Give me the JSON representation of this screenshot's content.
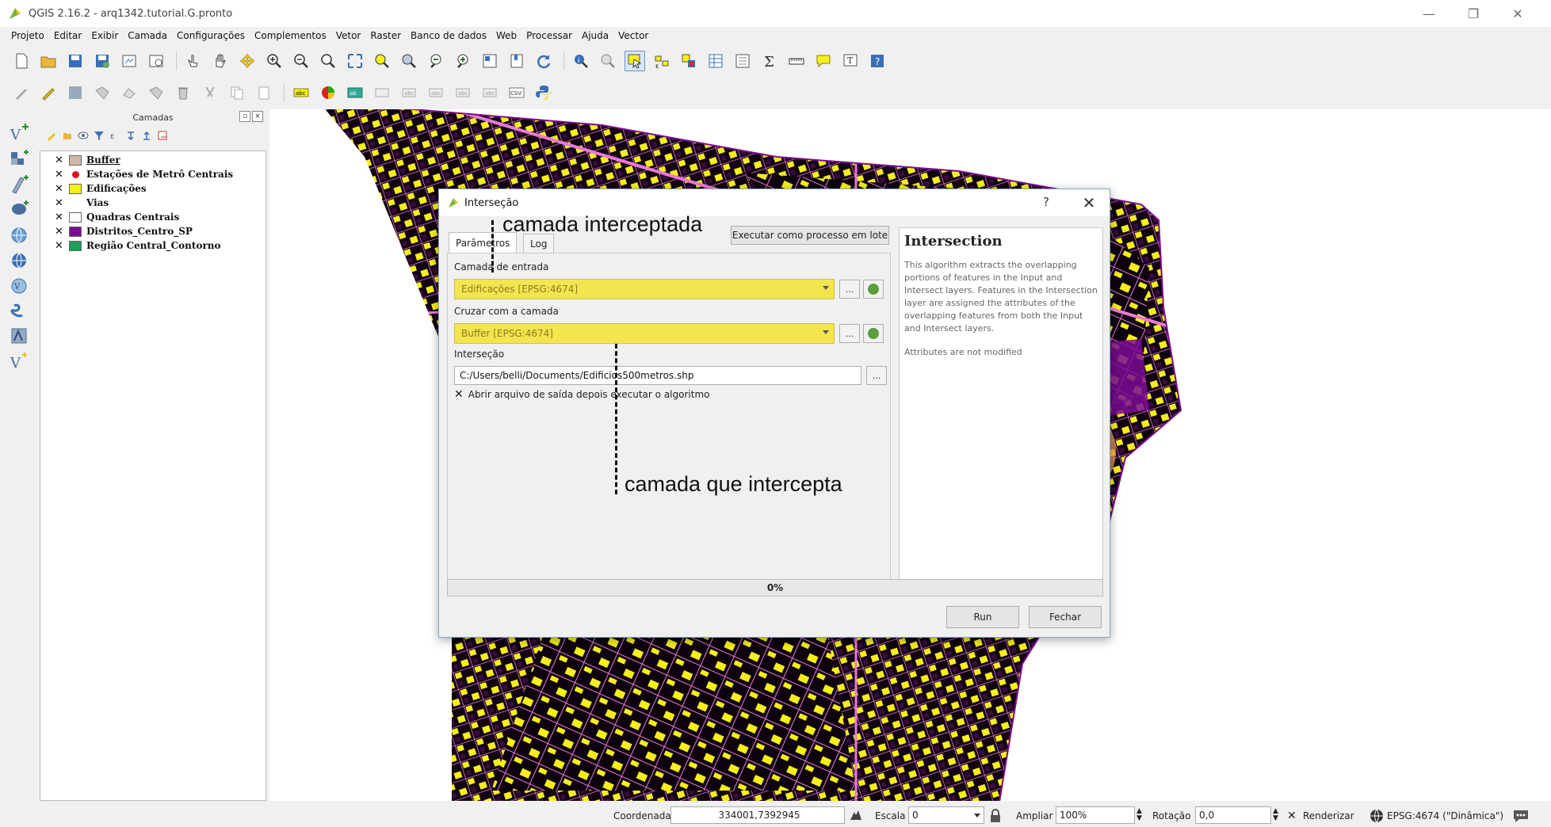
{
  "window": {
    "title": "QGIS 2.16.2 - arq1342.tutorial.G.pronto",
    "minimize": "—",
    "maximize": "❐",
    "close": "✕"
  },
  "menu": [
    "Projeto",
    "Editar",
    "Exibir",
    "Camada",
    "Configurações",
    "Complementos",
    "Vetor",
    "Raster",
    "Banco de dados",
    "Web",
    "Processar",
    "Ajuda",
    "Vector"
  ],
  "layers_panel": {
    "title": "Camadas",
    "layers": [
      {
        "name": "Buffer",
        "checked": "✕",
        "color": "#d2b8a8",
        "symbol": "fill",
        "underline": true
      },
      {
        "name": "Estações de Metrô Centrais",
        "checked": "✕",
        "color": "#d8131f",
        "symbol": "point"
      },
      {
        "name": "Edificações",
        "checked": "✕",
        "color": "#f6ef1a",
        "symbol": "fill"
      },
      {
        "name": "Vias",
        "checked": "✕",
        "color": "#ffffff",
        "symbol": "line"
      },
      {
        "name": "Quadras Centrais",
        "checked": "✕",
        "color": "#ffffff",
        "symbol": "fill"
      },
      {
        "name": "Distritos_Centro_SP",
        "checked": "✕",
        "color": "#7d0a95",
        "symbol": "fill"
      },
      {
        "name": "Região Central_Contorno",
        "checked": "✕",
        "color": "#1aa05a",
        "symbol": "fill"
      }
    ]
  },
  "dialog": {
    "title": "Interseção",
    "help_button": "?",
    "close_button": "✕",
    "tabs": [
      "Parâmetros",
      "Log"
    ],
    "batch_button": "Executar como processo em lote",
    "input_label": "Camada de entrada",
    "input_value": "Edificações [EPSG:4674]",
    "overlay_label": "Cruzar com a camada",
    "overlay_value": "Buffer [EPSG:4674]",
    "output_label": "Interseção",
    "output_value": "C:/Users/belli/Documents/Edificios500metros.shp",
    "browse_label": "...",
    "open_checkbox_label": "Abrir arquivo de saída depois executar o algoritmo",
    "open_checkbox_mark": "✕",
    "help_title": "Intersection",
    "help_body": "This algorithm extracts the overlapping portions of features in the Input and Intersect layers. Features in the Intersection layer are assigned the attributes of the overlapping features from both the Input and Intersect layers.",
    "help_attrs": "Attributes are not modified",
    "progress_text": "0%",
    "progress_value": 0,
    "run_button": "Run",
    "close_dialog_button": "Fechar"
  },
  "annotations": {
    "intercepted": "camada interceptada",
    "intercepting": "camada que intercepta"
  },
  "statusbar": {
    "coord_label": "Coordenada",
    "coord_value": "334001,7392945",
    "scale_label": "Escala",
    "scale_value": "0",
    "zoom_label": "Ampliar",
    "zoom_value": "100%",
    "rotation_label": "Rotação",
    "rotation_value": "0,0",
    "render_mark": "✕",
    "render_label": "Renderizar",
    "crs_label": "EPSG:4674 (\"Dinâmica\")"
  },
  "colors": {
    "district": "#7d0a95",
    "buildings": "#f6ef1a",
    "streets": "#e87ad6",
    "buffer": "#f4a25a",
    "combo_highlight": "#f3e54f"
  }
}
